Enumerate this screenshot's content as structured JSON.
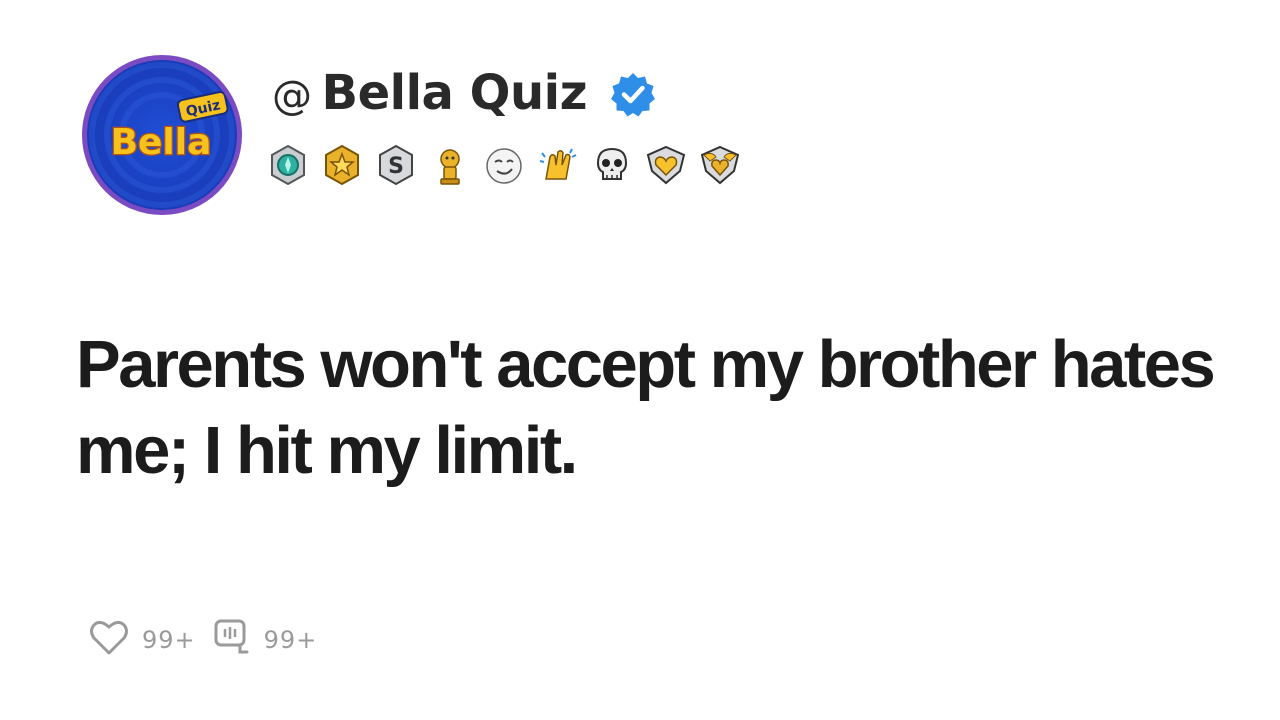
{
  "profile": {
    "avatar_text_main": "Bella",
    "avatar_text_tag": "Quiz",
    "at_sign": "@",
    "name": "Bella Quiz",
    "verified_icon": "verified-check-icon",
    "colors": {
      "avatar_ring": "#7b4bc4",
      "avatar_bg": "#1a3fbf",
      "logo_yellow": "#f7c21b",
      "verified": "#2f8fe8"
    }
  },
  "badges": [
    "teal-gem-badge-icon",
    "gold-star-badge-icon",
    "silver-s-badge-icon",
    "gold-trophy-badge-icon",
    "smirk-face-badge-icon",
    "clapping-hands-badge-icon",
    "skull-badge-icon",
    "gold-heart-shield-badge-icon",
    "winged-heart-badge-icon"
  ],
  "post": {
    "text": "Parents won't accept my brother hates me; I hit my limit."
  },
  "stats": {
    "likes": "99+",
    "comments": "99+",
    "like_icon": "heart-outline-icon",
    "comment_icon": "comment-bubble-icon"
  }
}
